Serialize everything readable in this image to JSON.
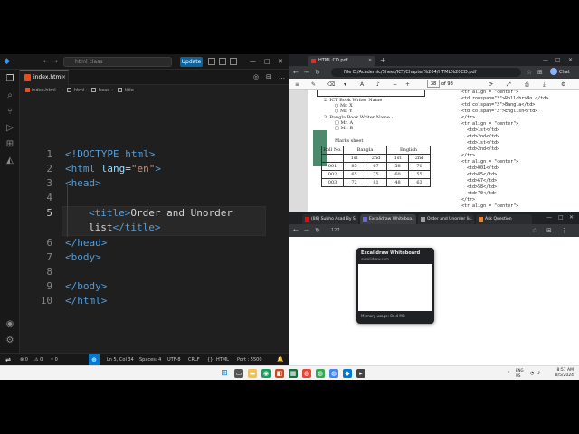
{
  "vscode": {
    "search_text": "html class",
    "update_label": "Update",
    "tab": {
      "label": "index.html",
      "close": "×"
    },
    "breadcrumb": [
      "index.html",
      "html",
      "head",
      "title"
    ],
    "line_numbers": [
      "1",
      "2",
      "3",
      "4",
      "5",
      "",
      "6",
      "7",
      "8",
      "9",
      "10"
    ],
    "code": {
      "l1_tag": "<!DOCTYPE html>",
      "l2_open": "<html",
      "l2_attr": " lang",
      "l2_eq": "=",
      "l2_val": "\"en\"",
      "l2_close": ">",
      "l3": "<head>",
      "l5_open": "<title>",
      "l5_text": "Order and Unorder",
      "l5b_text": "list",
      "l5b_close": "</title>",
      "l6": "</head>",
      "l7": "<body>",
      "l9": "</body>",
      "l10": "</html>"
    },
    "status": {
      "errors": "⊗ 0",
      "warnings": "⚠ 0",
      "ports": "⑂ 0",
      "cursor": "Ln 5, Col 34",
      "spaces": "Spaces: 4",
      "encoding": "UTF-8",
      "eol": "CRLF",
      "language": "HTML",
      "port": "Port : 5500"
    }
  },
  "browser": {
    "tab_title": "HTML CD.pdf",
    "url": "File   E:/Academic/Sheet/ICT/Chapter%204/HTML%20CD.pdf",
    "chat_label": "Chat",
    "pdf_page": "38",
    "pdf_of": "of 98",
    "pdf_lines_left": [
      "2. ICT Book Writer Name :",
      "○ Mr. X",
      "○ Mr. Y",
      "3. Bangla Book Writer Name :",
      "□ Mr. A",
      "□ Mr. B",
      "Marks sheet"
    ],
    "pdf_table": [
      [
        "Roll No.",
        "Bangla",
        "",
        "English",
        ""
      ],
      [
        "",
        "1st",
        "2nd",
        "1st",
        "2nd"
      ],
      [
        "001",
        "85",
        "67",
        "58",
        "70"
      ],
      [
        "002",
        "65",
        "75",
        "60",
        "55"
      ],
      [
        "003",
        "72",
        "81",
        "48",
        "63"
      ]
    ],
    "pdf_lines_right": [
      "<tr align = \"center\">",
      "<td rowspan=\"2\">Roll<br>No.</td>",
      "<td colspan=\"2\">Bangla</td>",
      "<td colspan=\"2\">English</td>",
      "</tr>",
      "<tr align = \"center\">",
      "<td>1st</td>",
      "<td>2nd</td>",
      "<td>1st</td>",
      "<td>2nd</td>",
      "</tr>",
      "<tr align = \"center\">",
      "<td>001</td>",
      "<td>85</td>",
      "<td>67</td>",
      "<td>58</td>",
      "<td>70</td>",
      "</tr>",
      "<tr align = \"center\">",
      "<td>002</td>"
    ]
  },
  "browser2": {
    "tabs": [
      "(86) Subho Asad By S...",
      "Excalidraw Whiteboa...",
      "Order and Unorder lis...",
      "Ask Question"
    ],
    "url": "127",
    "hover_title": "Excalidraw Whiteboard",
    "hover_url": "excalidraw.com",
    "hover_memory": "Memory usage: 84.4 MB"
  },
  "taskbar": {
    "lang": "ENG\nUS",
    "time": "8:57 AM",
    "date": "8/5/2024"
  }
}
